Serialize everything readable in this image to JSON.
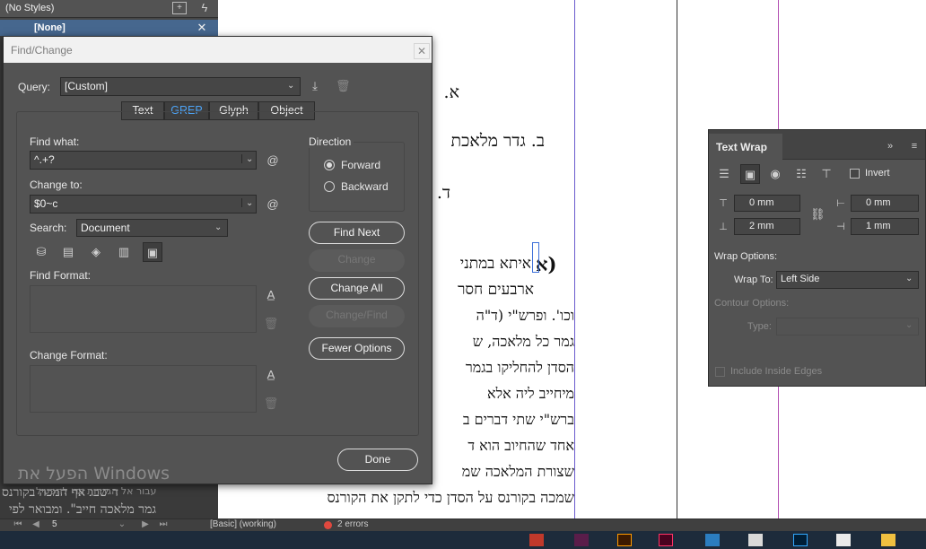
{
  "styles_panel": {
    "no_styles": "(No Styles)",
    "none_item": "[None]"
  },
  "document": {
    "lines": [
      "א.",
      "ב. גדר מלאכת",
      "ד.",
      "איתא במתני",
      "ארבעים חסר",
      "וכו'. ופרש\"י (ד\"ה",
      "גמר כל מלאכה, ש",
      "הסדן להחליקו בגמר",
      "מיחייב ליה אלא",
      "ברש\"י שתי דברים ב",
      "אחד שהחיוב הוא ד",
      "שצורת המלאכה שמ",
      "שמכה בקורנס על הסדן כדי לתקן את הקורנס",
      "גמר מלאכה חייב\". ומבואר לפי",
      "ד שבג אף המכה בקורנס"
    ],
    "side_mark": "(א",
    "watermark": "הפעל את Windows",
    "watermark_sub": "עבור אל הגדרות כדי להפעיל"
  },
  "find_change": {
    "title": "Find/Change",
    "query_label": "Query:",
    "query_value": "[Custom]",
    "tabs": [
      "Text",
      "GREP",
      "Glyph",
      "Object"
    ],
    "active_tab": "GREP",
    "find_what_label": "Find what:",
    "find_what_value": "^.+?",
    "change_to_label": "Change to:",
    "change_to_value": "$0~c",
    "search_label": "Search:",
    "search_value": "Document",
    "find_format_label": "Find Format:",
    "change_format_label": "Change Format:",
    "direction_label": "Direction",
    "forward_label": "Forward",
    "backward_label": "Backward",
    "direction_value": "Forward",
    "buttons": {
      "find_next": "Find Next",
      "change": "Change",
      "change_all": "Change All",
      "change_find": "Change/Find",
      "fewer_options": "Fewer Options",
      "done": "Done"
    },
    "at_symbol": "@"
  },
  "text_wrap": {
    "title": "Text Wrap",
    "invert_label": "Invert",
    "top_offset": "0 mm",
    "bottom_offset": "2 mm",
    "left_offset": "0 mm",
    "right_offset": "1 mm",
    "wrap_options_label": "Wrap Options:",
    "wrap_to_label": "Wrap To:",
    "wrap_to_value": "Left Side",
    "contour_options_label": "Contour Options:",
    "type_label": "Type:",
    "include_inside_edges": "Include Inside Edges"
  },
  "status_bar": {
    "page": "5",
    "style": "[Basic] (working)",
    "errors": "2 errors"
  },
  "colors": {
    "accent": "#4da3f5",
    "selection": "#46678e",
    "error": "#e0483e"
  }
}
